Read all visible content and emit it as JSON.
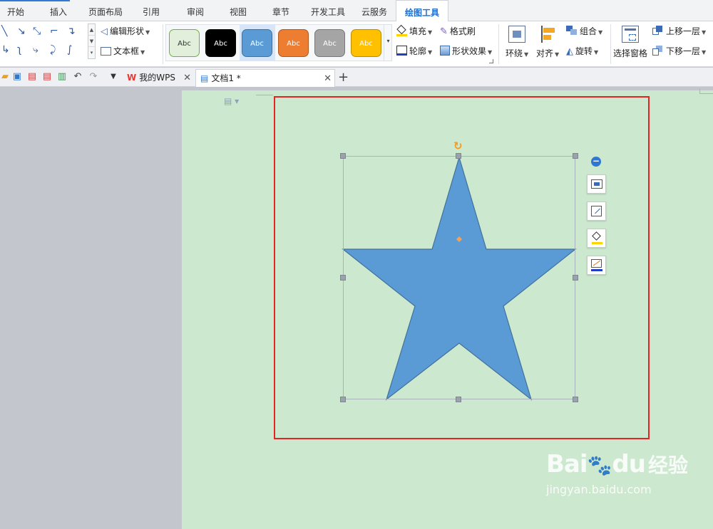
{
  "tabs": [
    "开始",
    "插入",
    "页面布局",
    "引用",
    "审阅",
    "视图",
    "章节",
    "开发工具",
    "云服务",
    "绘图工具"
  ],
  "ribbon": {
    "edit_shape": "编辑形状",
    "text_box": "文本框",
    "style_label": "Abc",
    "fill": "填充",
    "format_painter": "格式刷",
    "outline": "轮廓",
    "shape_effects": "形状效果",
    "wrap": "环绕",
    "align": "对齐",
    "group": "组合",
    "rotate": "旋转",
    "selection_pane": "选择窗格",
    "bring_forward": "上移一层",
    "send_backward": "下移一层"
  },
  "quick_bar": {
    "tab_wps": "我的WPS",
    "tab_doc": "文档1 *"
  },
  "colors": {
    "accent_blue": "#2f7ad6",
    "star_fill": "#5b9bd5",
    "star_stroke": "#41719c",
    "page_bg": "#cce8cf",
    "highlight_red": "#e52323",
    "rotate_orange": "#f29b22",
    "style_swatches": [
      "#e2efda",
      "#000000",
      "#5b9bd5",
      "#ed7d31",
      "#a5a5a5",
      "#ffc000"
    ]
  },
  "float_tools": [
    "layout-options-icon",
    "edit-shape-icon",
    "fill-color-icon",
    "outline-color-icon"
  ],
  "watermark": {
    "logo": "Bai",
    "logo2": "du",
    "cn": "经验",
    "url": "jingyan.baidu.com"
  }
}
